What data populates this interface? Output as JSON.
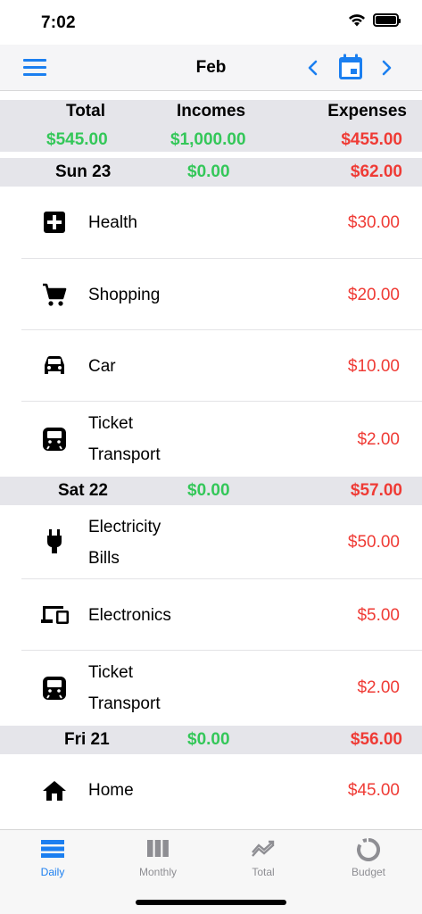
{
  "status": {
    "time": "7:02"
  },
  "nav": {
    "title": "Feb"
  },
  "summary": {
    "total_label": "Total",
    "total_value": "$545.00",
    "incomes_label": "Incomes",
    "incomes_value": "$1,000.00",
    "expenses_label": "Expenses",
    "expenses_value": "$455.00"
  },
  "days": [
    {
      "label": "Sun 23",
      "income": "$0.00",
      "expense": "$62.00",
      "items": [
        {
          "icon": "health-icon",
          "label": "Health",
          "amount": "$30.00"
        },
        {
          "icon": "cart-icon",
          "label": "Shopping",
          "amount": "$20.00"
        },
        {
          "icon": "car-icon",
          "label": "Car",
          "amount": "$10.00"
        },
        {
          "icon": "bus-icon",
          "line1": "Ticket",
          "line2": "Transport",
          "amount": "$2.00"
        }
      ]
    },
    {
      "label": "Sat 22",
      "income": "$0.00",
      "expense": "$57.00",
      "items": [
        {
          "icon": "plug-icon",
          "line1": "Electricity",
          "line2": "Bills",
          "amount": "$50.00"
        },
        {
          "icon": "devices-icon",
          "label": "Electronics",
          "amount": "$5.00"
        },
        {
          "icon": "bus-icon",
          "line1": "Ticket",
          "line2": "Transport",
          "amount": "$2.00"
        }
      ]
    },
    {
      "label": "Fri 21",
      "income": "$0.00",
      "expense": "$56.00",
      "items": [
        {
          "icon": "home-icon",
          "label": "Home",
          "amount": "$45.00"
        }
      ]
    }
  ],
  "tabs": [
    {
      "label": "Daily",
      "icon": "daily-icon",
      "active": true
    },
    {
      "label": "Monthly",
      "icon": "monthly-icon"
    },
    {
      "label": "Total",
      "icon": "total-icon"
    },
    {
      "label": "Budget",
      "icon": "budget-icon"
    }
  ],
  "colors": {
    "accent": "#1b7ff0",
    "income": "#34c759",
    "expense": "#ef3b35",
    "header_bg": "#e5e5ea"
  }
}
